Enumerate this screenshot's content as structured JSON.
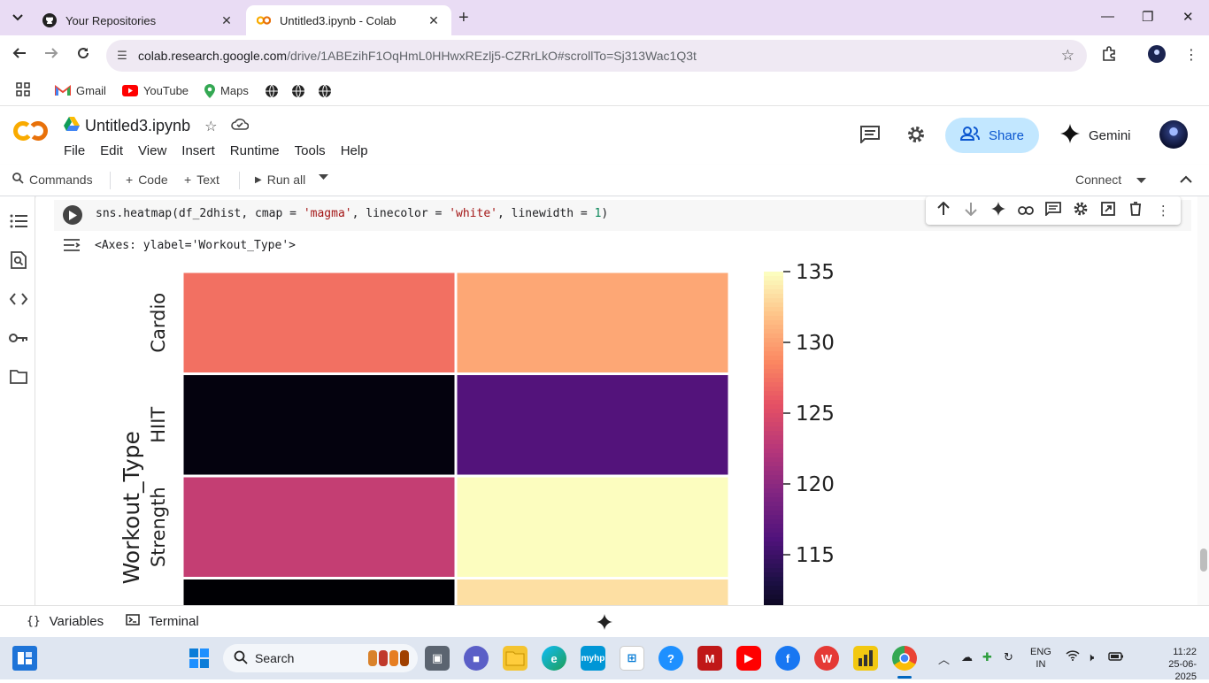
{
  "browser": {
    "tabs": [
      {
        "title": "Your Repositories",
        "icon": "github-icon",
        "active": false
      },
      {
        "title": "Untitled3.ipynb - Colab",
        "icon": "colab-icon",
        "active": true
      }
    ],
    "url_host": "colab.research.google.com",
    "url_path": "/drive/1ABEzihF1OqHmL0HHwxREzlj5-CZRrLkO#scrollTo=Sj313Wac1Q3t",
    "bookmarks": [
      {
        "label": "Gmail",
        "icon": "gmail-icon"
      },
      {
        "label": "YouTube",
        "icon": "youtube-icon"
      },
      {
        "label": "Maps",
        "icon": "maps-icon"
      }
    ]
  },
  "colab": {
    "notebook_title": "Untitled3.ipynb",
    "menu": [
      "File",
      "Edit",
      "View",
      "Insert",
      "Runtime",
      "Tools",
      "Help"
    ],
    "share_label": "Share",
    "gemini_label": "Gemini",
    "toolbar": {
      "commands": "Commands",
      "code": "Code",
      "text": "Text",
      "run_all": "Run all",
      "connect": "Connect"
    },
    "cell": {
      "code_prefix": "sns.heatmap(df_2dhist, cmap = ",
      "str1": "'magma'",
      "mid1": ", linecolor = ",
      "str2": "'white'",
      "mid2": ", linewidth = ",
      "num1": "1",
      "close": ")",
      "output": "<Axes: ylabel='Workout_Type'>"
    },
    "statusbar": {
      "variables": "Variables",
      "terminal": "Terminal"
    }
  },
  "chart_data": {
    "type": "heatmap",
    "ylabel": "Workout_Type",
    "rows": [
      "Cardio",
      "HIIT",
      "Strength",
      ""
    ],
    "columns": 2,
    "values": [
      [
        127.5,
        130.5
      ],
      [
        110.5,
        116.5
      ],
      [
        123.5,
        135.0
      ],
      [
        110.0,
        133.5
      ]
    ],
    "colorbar_ticks": [
      "135",
      "130",
      "125",
      "120",
      "115"
    ],
    "colorbar_range": [
      110,
      135
    ],
    "cmap": "magma",
    "linecolor": "white"
  },
  "taskbar": {
    "search_label": "Search",
    "lang_top": "ENG",
    "lang_bottom": "IN",
    "time": "11:22",
    "date": "25-06-2025"
  }
}
